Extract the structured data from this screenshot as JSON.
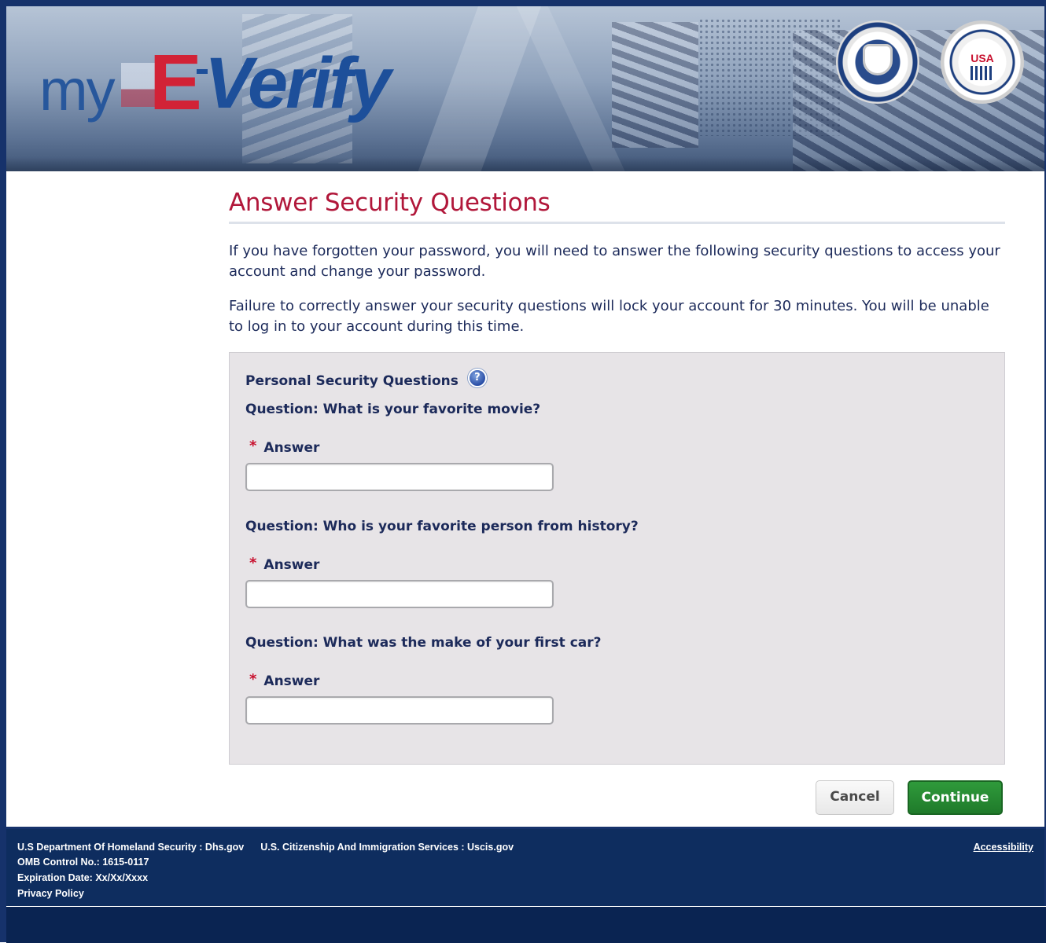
{
  "header": {
    "logo_my": "my",
    "logo_e": "E",
    "logo_verify": "Verify",
    "seal_dhs_name": "dhs-seal",
    "seal_ssa_usa": "USA"
  },
  "page": {
    "title": "Answer Security Questions",
    "intro1": "If you have forgotten your password, you will need to answer the following security questions to access your account and change your password.",
    "intro2": "Failure to correctly answer your security questions will lock your account for 30 minutes. You will be unable to log in to your account during this time."
  },
  "panel": {
    "title": "Personal Security Questions",
    "help_icon": "?",
    "questions": [
      {
        "question": "Question: What is your favorite movie?",
        "answer_label": "Answer",
        "required_mark": "*",
        "value": ""
      },
      {
        "question": "Question: Who is your favorite person from history?",
        "answer_label": "Answer",
        "required_mark": "*",
        "value": ""
      },
      {
        "question": "Question: What was the make of your first car?",
        "answer_label": "Answer",
        "required_mark": "*",
        "value": ""
      }
    ]
  },
  "buttons": {
    "cancel": "Cancel",
    "continue": "Continue"
  },
  "footer": {
    "dhs": "U.S Department Of Homeland Security : Dhs.gov",
    "uscis": "U.S. Citizenship And Immigration Services : Uscis.gov",
    "omb": "OMB Control No.: 1615-0117",
    "expiration": "Expiration Date: Xx/Xx/Xxxx",
    "privacy": "Privacy Policy",
    "accessibility": "Accessibility"
  },
  "colors": {
    "title_red": "#b1173a",
    "text_navy": "#1c2a5a",
    "continue_green": "#1f7a2a",
    "footer_navy": "#0e2d5f"
  }
}
